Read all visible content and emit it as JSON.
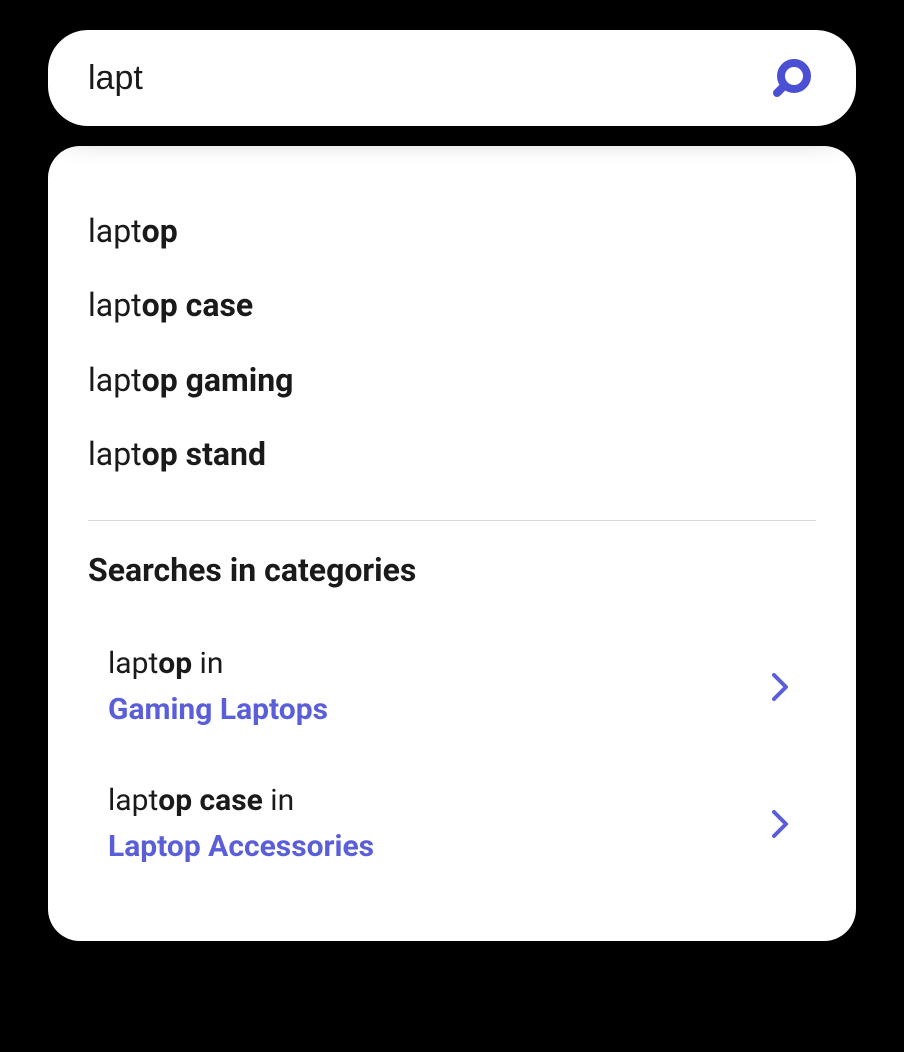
{
  "search": {
    "value": "lapt",
    "placeholder": ""
  },
  "colors": {
    "accent": "#4a4fd4"
  },
  "suggestions": [
    {
      "prefix": "lapt",
      "rest": "op"
    },
    {
      "prefix": "lapt",
      "rest": "op case"
    },
    {
      "prefix": "lapt",
      "rest": "op gaming"
    },
    {
      "prefix": "lapt",
      "rest": "op stand"
    }
  ],
  "section_header": "Searches in categories",
  "in_word": "in",
  "category_suggestions": [
    {
      "term_prefix": "lapt",
      "term_rest": "op",
      "category": "Gaming Laptops"
    },
    {
      "term_prefix": "lapt",
      "term_rest": "op case",
      "category": "Laptop Accessories"
    }
  ]
}
